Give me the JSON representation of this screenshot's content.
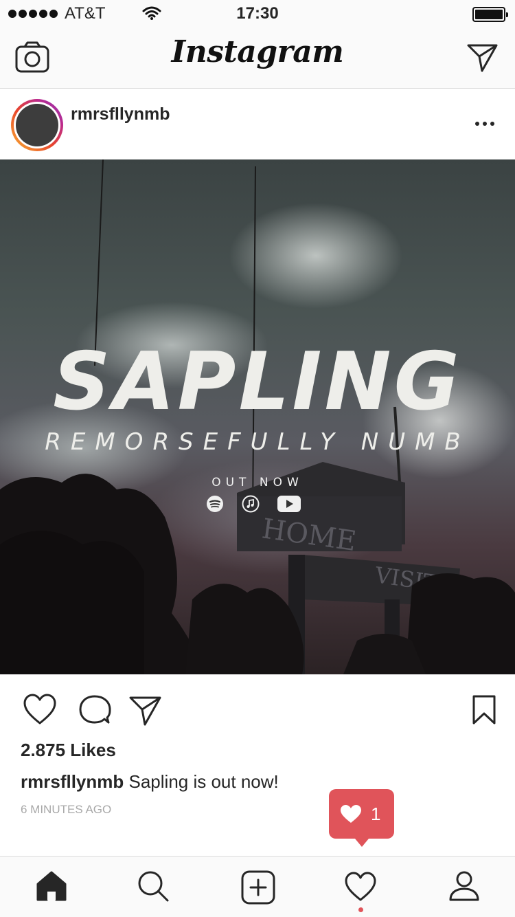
{
  "status_bar": {
    "carrier": "AT&T",
    "time": "17:30"
  },
  "nav": {
    "logo": "Instagram",
    "camera_icon": "camera-icon",
    "direct_icon": "paper-plane-icon"
  },
  "post": {
    "username": "rmrsfllynmb",
    "image": {
      "title": "SAPLING",
      "subtitle": "REMORSEFULLY NUMB",
      "tagline": "OUT NOW",
      "sign_home": "HOME",
      "sign_visitor": "VISITOR",
      "stream_icons": [
        "spotify-icon",
        "apple-music-icon",
        "youtube-icon"
      ]
    },
    "likes": "2.875 Likes",
    "caption_user": "rmrsfllynmb",
    "caption_text": "Sapling is out now!",
    "time_ago": "6 MINUTES AGO"
  },
  "notification": {
    "count": "1",
    "icon": "heart-icon",
    "color": "#e0545a"
  },
  "tabs": [
    "home-icon",
    "search-icon",
    "add-post-icon",
    "activity-heart-icon",
    "profile-icon"
  ]
}
